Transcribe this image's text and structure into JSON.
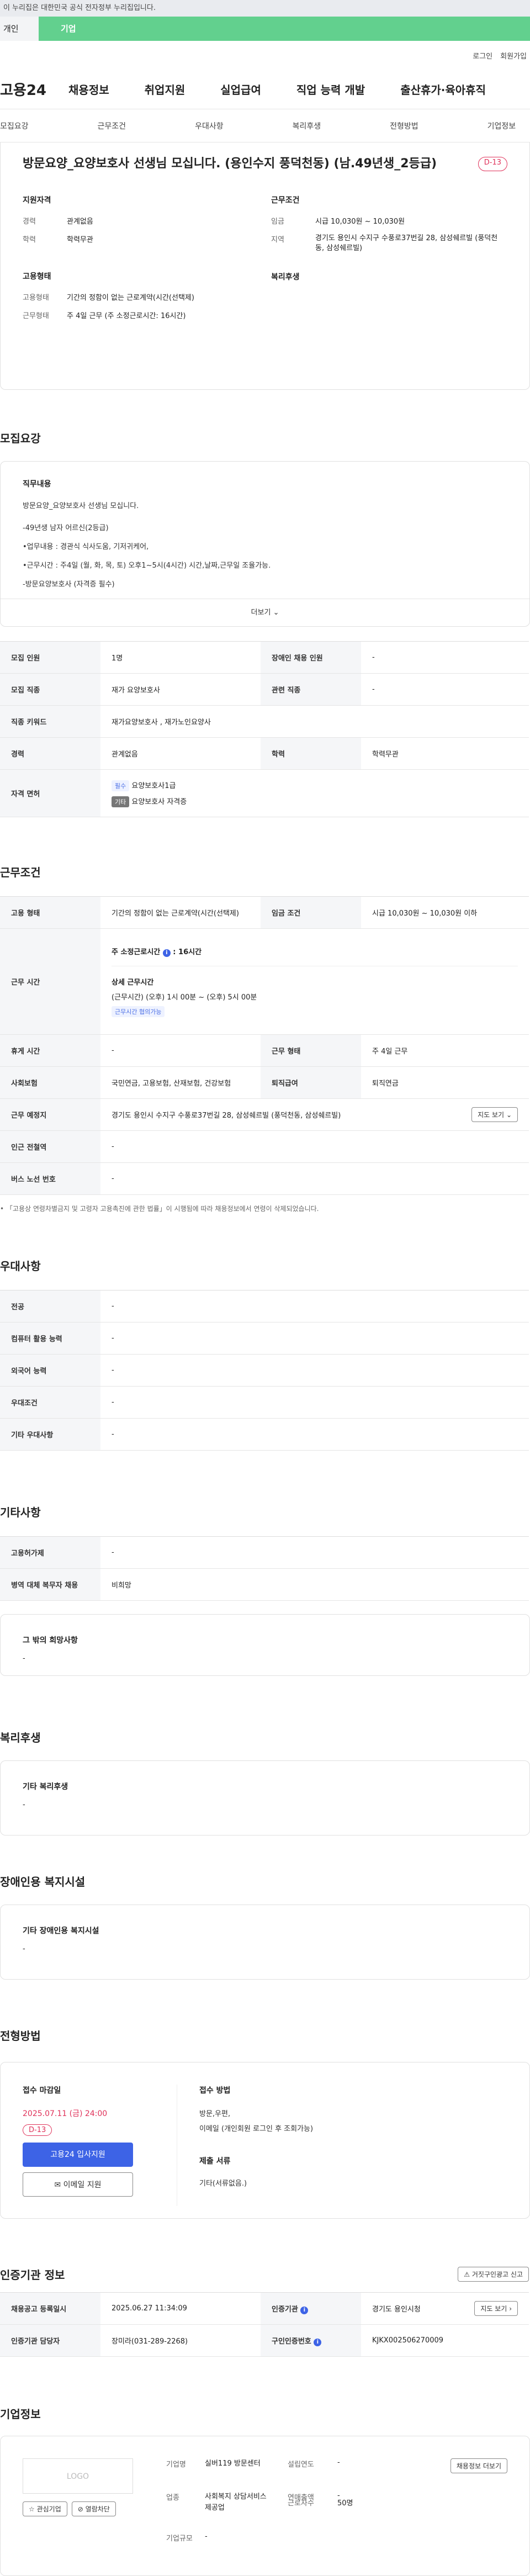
{
  "banner": "이 누리집은 대한민국 공식 전자정부 누리집입니다.",
  "top_tabs": [
    "개인",
    "기업"
  ],
  "util": [
    "로그인",
    "회원가입"
  ],
  "gnb": {
    "logo": "고용24",
    "menu": [
      "채용정보",
      "취업지원",
      "실업급여",
      "직업 능력 개발",
      "출산휴가·육아휴직"
    ]
  },
  "subnav": [
    "모집요강",
    "근무조건",
    "우대사항",
    "복리후생",
    "전형방법",
    "기업정보"
  ],
  "header": {
    "title": "방문요양_요양보호사 선생님 모십니다. (용인수지 풍덕천동) (남.49년생_2등급)",
    "dday": "D-13",
    "apply_title": "지원자격",
    "work_title": "근무조건",
    "emp_title": "고용형태",
    "welfare_title": "복리후생",
    "career_label": "경력",
    "career": "관계없음",
    "edu_label": "학력",
    "edu": "학력무관",
    "wage_label": "임금",
    "wage": "시급 10,030원 ~ 10,030원",
    "area_label": "지역",
    "area": "경기도 용인시 수지구 수풍로37번길 28, 삼성쉐르빌 (풍덕천동, 삼성쉐르빌)",
    "emp_label": "고용형태",
    "emp": "기간의 정함이 없는 근로계약(시간(선택제)",
    "hours_label": "근무형태",
    "hours": "주 4일 근무 (주 소정근로시간: 16시간)"
  },
  "recruit": {
    "title": "모집요강",
    "duty_title": "직무내용",
    "lines": [
      "방문요양_요양보호사 선생님 모십니다.",
      "-49년생 남자 어르신(2등급)",
      "•업무내용 : 경관식 식사도움, 기저귀케어,",
      "•근무시간 : 주4일 (월, 화, 목, 토) 오후1~5시(4시간) 시간,날짜,근무일 조율가능.",
      "-방문요양보호사 (자격증 필수)"
    ],
    "more": "더보기",
    "rows": [
      {
        "k": "모집 인원",
        "v": "1명",
        "k2": "장애인 채용 인원",
        "v2": "-"
      },
      {
        "k": "모집 직종",
        "v": "재가 요양보호사",
        "k2": "관련 직종",
        "v2": "-"
      },
      {
        "k": "직종 키워드",
        "v": "재가요양보호사 , 재가노인요양사"
      },
      {
        "k": "경력",
        "v": "관계없음",
        "k2": "학력",
        "v2": "학력무관"
      }
    ],
    "license_label": "자격 면허",
    "lic_tag1": "필수",
    "lic1": "요양보호사1급",
    "lic_tag2": "기타",
    "lic2": "요양보호사 자격증"
  },
  "work": {
    "title": "근무조건",
    "emp_label": "고용 형태",
    "emp": "기간의 정함이 없는 근로계약(시간(선택제)",
    "wage_label": "임금 조건",
    "wage": "시급 10,030원 ~ 10,030원 이하",
    "time_label": "근무 시간",
    "weekly": "주 소정근로시간",
    "weekly_val": "16시간",
    "detail_title": "상세 근무시간",
    "detail": "(근무시간) (오후) 1시 00분 ~ (오후) 5시 00분",
    "nego": "근무시간 협의가능",
    "rest_label": "휴게 시간",
    "rest": "-",
    "type_label": "근무 형태",
    "type": "주 4일 근무",
    "ins_label": "사회보험",
    "ins": "국민연금, 고용보험, 산재보험, 건강보험",
    "ret_label": "퇴직급여",
    "ret": "퇴직연금",
    "place_label": "근무 예정지",
    "place": "경기도 용인시 수지구 수풍로37번길 28, 삼성쉐르빌 (풍덕천동, 삼성쉐르빌)",
    "map": "지도 보기",
    "sub_label": "인근 전철역",
    "sub": "-",
    "bus_label": "버스 노선 번호",
    "bus": "-",
    "note": "「고용상 연령차별금지 및 고령자 고용촉진에 관한 법률」이 시행됨에 따라 채용정보에서 연령이 삭제되었습니다."
  },
  "pref": {
    "title": "우대사항",
    "rows": [
      {
        "k": "전공",
        "v": "-"
      },
      {
        "k": "컴퓨터 활용 능력",
        "v": "-"
      },
      {
        "k": "외국어 능력",
        "v": "-"
      },
      {
        "k": "우대조건",
        "v": "-"
      },
      {
        "k": "기타 우대사항",
        "v": "-"
      }
    ]
  },
  "etc": {
    "title": "기타사항",
    "rows": [
      {
        "k": "고용허가제",
        "v": "-"
      },
      {
        "k": "병역 대체 복무자 채용",
        "v": "비희망"
      }
    ],
    "other_title": "그 밖의 희망사항",
    "other": "-"
  },
  "welfare": {
    "title": "복리후생",
    "sub": "기타 복리후생",
    "val": "-"
  },
  "disabled": {
    "title": "장애인용 복지시설",
    "sub": "기타 장애인용 복지시설",
    "val": "-"
  },
  "process": {
    "title": "전형방법",
    "deadline_label": "접수 마감일",
    "deadline": "2025.07.11 (금) 24:00",
    "dday": "D-13",
    "apply_btn": "고용24 입사지원",
    "email_btn": "이메일 지원",
    "method_title": "접수 방법",
    "method": "방문,우편,",
    "method2": "이메일 (개인회원 로그인 후 조회가능)",
    "docs_title": "제출 서류",
    "docs": "기타(서류없음.)"
  },
  "cert": {
    "title": "인증기관 정보",
    "report": "거짓구인광고 신고",
    "reg_label": "채용공고 등록일시",
    "reg": "2025.06.27 11:34:09",
    "org_label": "인증기관",
    "org": "경기도 용인시청",
    "map": "지도 보기",
    "mgr_label": "인증기관 담당자",
    "mgr": "장미라(031-289-2268)",
    "id_label": "구인인증번호",
    "id": "KJKX002506270009"
  },
  "company": {
    "title": "기업정보",
    "logo": "LOGO",
    "fav": "관심기업",
    "block": "열람차단",
    "jobs": "채용정보 더보기",
    "name_label": "기업명",
    "name": "실버119 방문센터",
    "year_label": "설립연도",
    "year": "-",
    "industry_label": "업종",
    "industry": "사회복지 상담서비스 제공업",
    "sales_label": "연매출액",
    "sales": "-",
    "emp_label": "근로자수",
    "emp": "50명",
    "size_label": "기업규모",
    "size": "-"
  }
}
